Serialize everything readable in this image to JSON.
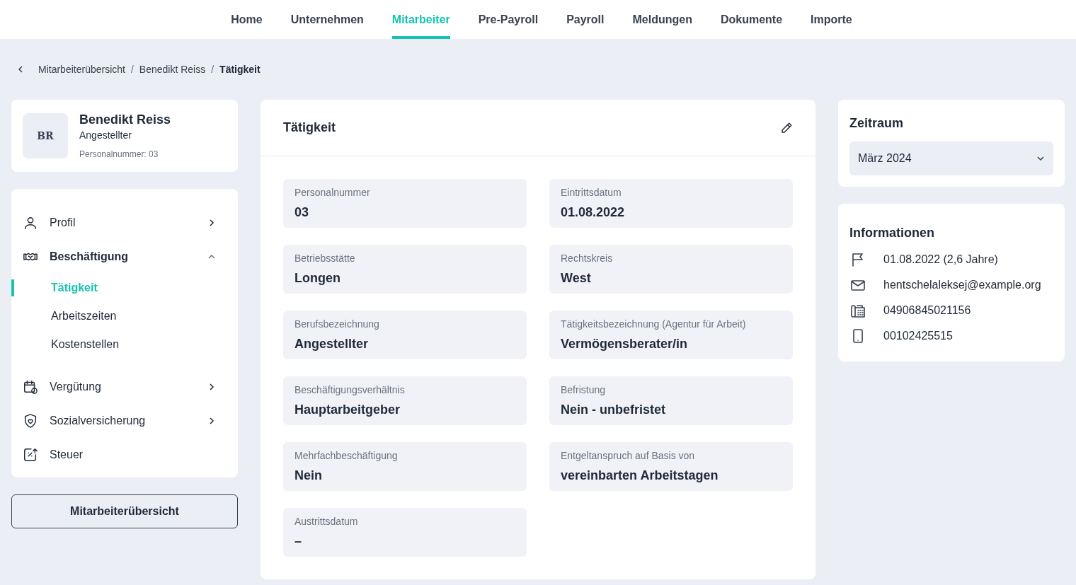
{
  "nav": [
    {
      "label": "Home",
      "selected": false
    },
    {
      "label": "Unternehmen",
      "selected": false
    },
    {
      "label": "Mitarbeiter",
      "selected": true
    },
    {
      "label": "Pre-Payroll",
      "selected": false
    },
    {
      "label": "Payroll",
      "selected": false
    },
    {
      "label": "Meldungen",
      "selected": false
    },
    {
      "label": "Dokumente",
      "selected": false
    },
    {
      "label": "Importe",
      "selected": false
    }
  ],
  "breadcrumb_separator": "/",
  "breadcrumb": [
    {
      "label": "Mitarbeiterübersicht",
      "current": false
    },
    {
      "label": "Benedikt Reiss",
      "current": false
    },
    {
      "label": "Tätigkeit",
      "current": true
    }
  ],
  "profile": {
    "initials": "BR",
    "name": "Benedikt Reiss",
    "role": "Angestellter",
    "number_label": "Personalnummer:",
    "number": "03"
  },
  "sidebar": {
    "items": [
      {
        "label": "Profil",
        "kind": "group",
        "expanded": false
      },
      {
        "label": "Beschäftigung",
        "kind": "group",
        "expanded": true,
        "children": [
          {
            "label": "Tätigkeit",
            "selected": true
          },
          {
            "label": "Arbeitszeiten",
            "selected": false
          },
          {
            "label": "Kostenstellen",
            "selected": false
          }
        ]
      },
      {
        "label": "Vergütung",
        "kind": "group",
        "expanded": false
      },
      {
        "label": "Sozialversicherung",
        "kind": "group",
        "expanded": false
      },
      {
        "label": "Steuer",
        "kind": "link"
      }
    ]
  },
  "overview_button": "Mitarbeiterübersicht",
  "panel": {
    "title": "Tätigkeit",
    "fields": [
      {
        "label": "Personalnummer",
        "value": "03"
      },
      {
        "label": "Eintrittsdatum",
        "value": "01.08.2022"
      },
      {
        "label": "Betriebsstätte",
        "value": "Longen"
      },
      {
        "label": "Rechtskreis",
        "value": "West"
      },
      {
        "label": "Berufsbezeichnung",
        "value": "Angestellter"
      },
      {
        "label": "Tätigkeitsbezeichnung (Agentur für Arbeit)",
        "value": "Vermögensberater/in"
      },
      {
        "label": "Beschäftigungsverhältnis",
        "value": "Hauptarbeitgeber"
      },
      {
        "label": "Befristung",
        "value": "Nein - unbefristet"
      },
      {
        "label": "Mehrfachbeschäftigung",
        "value": "Nein"
      },
      {
        "label": "Entgeltanspruch auf Basis von",
        "value": "vereinbarten Arbeitstagen"
      },
      {
        "label": "Austrittsdatum",
        "value": "–"
      }
    ]
  },
  "period": {
    "title": "Zeitraum",
    "value": "März 2024"
  },
  "info": {
    "title": "Informationen",
    "items": [
      {
        "text": "01.08.2022 (2,6 Jahre)"
      },
      {
        "text": "hentschelaleksej@example.org"
      },
      {
        "text": "04906845021156"
      },
      {
        "text": "00102425515"
      }
    ]
  }
}
